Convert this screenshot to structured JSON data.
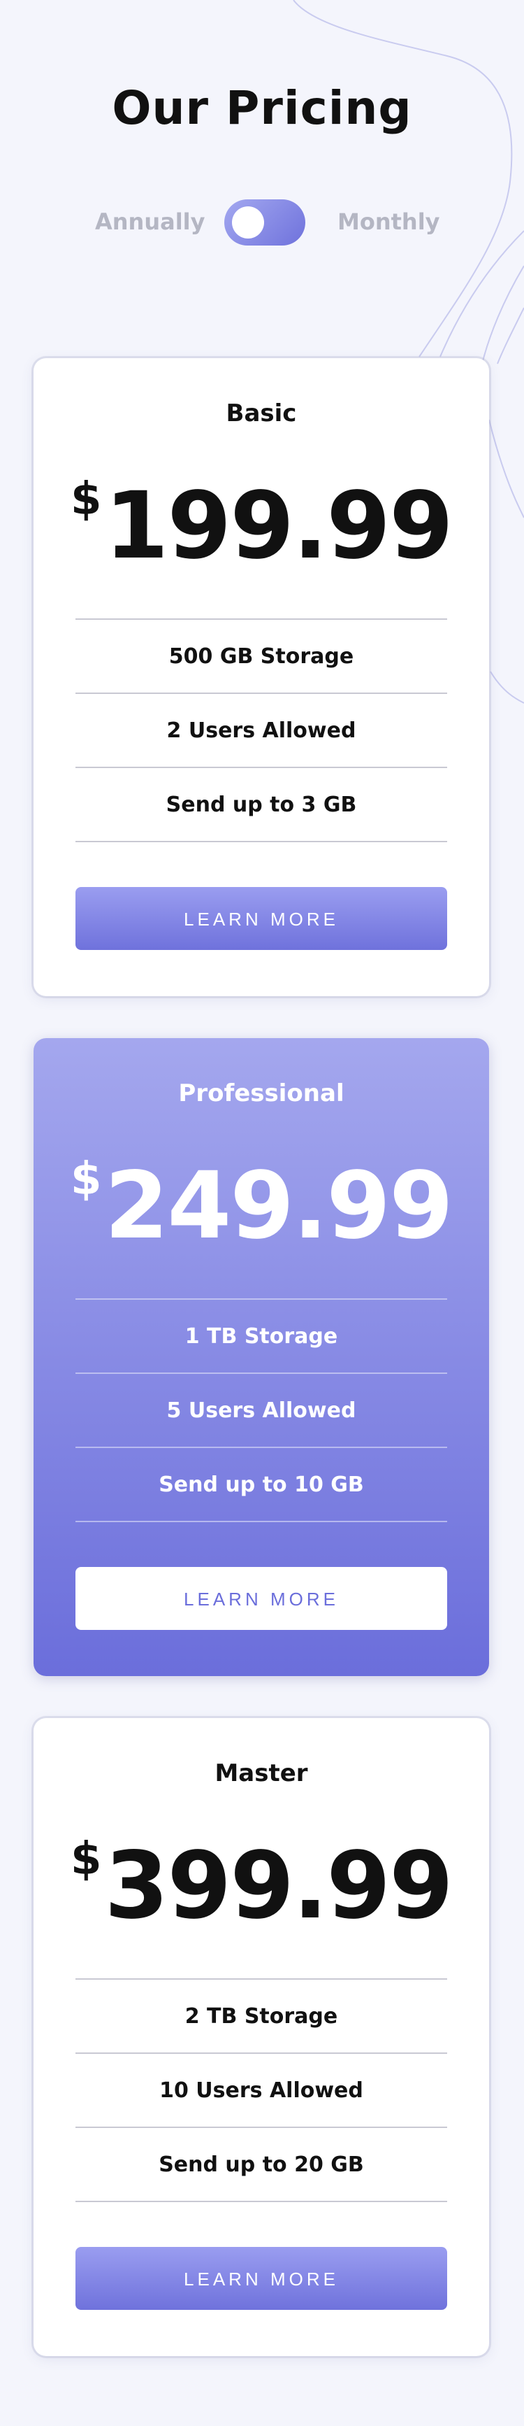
{
  "header": {
    "title": "Our Pricing",
    "billing_left": "Annually",
    "billing_right": "Monthly"
  },
  "plans": [
    {
      "name": "Basic",
      "currency": "$",
      "amount": "199.99",
      "features": [
        "500 GB Storage",
        "2 Users Allowed",
        "Send up to 3 GB"
      ],
      "button": "LEARN MORE"
    },
    {
      "name": "Professional",
      "currency": "$",
      "amount": "249.99",
      "features": [
        "1 TB Storage",
        "5 Users Allowed",
        "Send up to 10 GB"
      ],
      "button": "LEARN MORE"
    },
    {
      "name": "Master",
      "currency": "$",
      "amount": "399.99",
      "features": [
        "2 TB Storage",
        "10 Users Allowed",
        "Send up to 20 GB"
      ],
      "button": "LEARN MORE"
    }
  ],
  "colors": {
    "accent_start": "#a4a7ee",
    "accent_end": "#6b6edb",
    "background": "#f4f5fc"
  }
}
